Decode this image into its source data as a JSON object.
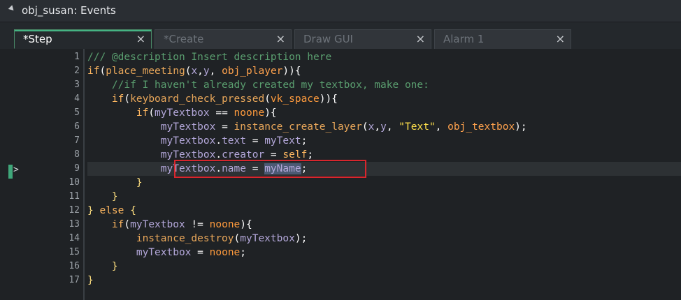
{
  "window": {
    "title": "obj_susan: Events"
  },
  "tabs": [
    {
      "label": "*Step",
      "close": "×",
      "active": true
    },
    {
      "label": "*Create",
      "close": "×",
      "active": false
    },
    {
      "label": "Draw GUI",
      "close": "×",
      "active": false
    },
    {
      "label": "Alarm 1",
      "close": "×",
      "active": false
    }
  ],
  "gutter": {
    "current_line_marker": ">"
  },
  "lines": [
    {
      "num": "1",
      "tokens": [
        {
          "t": "/// @description Insert description here",
          "c": "c-comment"
        }
      ]
    },
    {
      "num": "2",
      "tokens": [
        {
          "t": "if",
          "c": "c-kw"
        },
        {
          "t": "(",
          "c": "c-punct"
        },
        {
          "t": "place_meeting",
          "c": "c-fn"
        },
        {
          "t": "(",
          "c": "c-punct"
        },
        {
          "t": "x",
          "c": "c-var"
        },
        {
          "t": ",",
          "c": "c-punct"
        },
        {
          "t": "y",
          "c": "c-var"
        },
        {
          "t": ", ",
          "c": "c-punct"
        },
        {
          "t": "obj_player",
          "c": "c-obj"
        },
        {
          "t": ")){",
          "c": "c-punct"
        }
      ]
    },
    {
      "num": "3",
      "tokens": [
        {
          "t": "    //if I haven't already created my textbox, make one:",
          "c": "c-comment"
        }
      ]
    },
    {
      "num": "4",
      "tokens": [
        {
          "t": "    ",
          "c": "c-plain"
        },
        {
          "t": "if",
          "c": "c-kw"
        },
        {
          "t": "(",
          "c": "c-punct"
        },
        {
          "t": "keyboard_check_pressed",
          "c": "c-fn"
        },
        {
          "t": "(",
          "c": "c-punct"
        },
        {
          "t": "vk_space",
          "c": "c-const"
        },
        {
          "t": ")){",
          "c": "c-punct"
        }
      ]
    },
    {
      "num": "5",
      "tokens": [
        {
          "t": "        ",
          "c": "c-plain"
        },
        {
          "t": "if",
          "c": "c-kw"
        },
        {
          "t": "(",
          "c": "c-punct"
        },
        {
          "t": "myTextbox",
          "c": "c-var"
        },
        {
          "t": " == ",
          "c": "c-punct"
        },
        {
          "t": "noone",
          "c": "c-const"
        },
        {
          "t": "){",
          "c": "c-punct"
        }
      ]
    },
    {
      "num": "6",
      "tokens": [
        {
          "t": "            ",
          "c": "c-plain"
        },
        {
          "t": "myTextbox",
          "c": "c-var"
        },
        {
          "t": " = ",
          "c": "c-punct"
        },
        {
          "t": "instance_create_layer",
          "c": "c-fn"
        },
        {
          "t": "(",
          "c": "c-punct"
        },
        {
          "t": "x",
          "c": "c-var"
        },
        {
          "t": ",",
          "c": "c-punct"
        },
        {
          "t": "y",
          "c": "c-var"
        },
        {
          "t": ", ",
          "c": "c-punct"
        },
        {
          "t": "\"Text\"",
          "c": "c-str"
        },
        {
          "t": ", ",
          "c": "c-punct"
        },
        {
          "t": "obj_textbox",
          "c": "c-obj"
        },
        {
          "t": ");",
          "c": "c-punct"
        }
      ]
    },
    {
      "num": "7",
      "tokens": [
        {
          "t": "            ",
          "c": "c-plain"
        },
        {
          "t": "myTextbox",
          "c": "c-var"
        },
        {
          "t": ".",
          "c": "c-punct"
        },
        {
          "t": "text",
          "c": "c-var"
        },
        {
          "t": " = ",
          "c": "c-punct"
        },
        {
          "t": "myText",
          "c": "c-var"
        },
        {
          "t": ";",
          "c": "c-punct"
        }
      ]
    },
    {
      "num": "8",
      "tokens": [
        {
          "t": "            ",
          "c": "c-plain"
        },
        {
          "t": "myTextbox",
          "c": "c-var"
        },
        {
          "t": ".",
          "c": "c-punct"
        },
        {
          "t": "creator",
          "c": "c-var"
        },
        {
          "t": " = ",
          "c": "c-punct"
        },
        {
          "t": "self",
          "c": "c-self"
        },
        {
          "t": ";",
          "c": "c-punct"
        }
      ]
    },
    {
      "num": "9",
      "tokens": [
        {
          "t": "            ",
          "c": "c-plain"
        },
        {
          "t": "myTextbox",
          "c": "c-var"
        },
        {
          "t": ".",
          "c": "c-punct"
        },
        {
          "t": "name",
          "c": "c-var"
        },
        {
          "t": " = ",
          "c": "c-punct"
        },
        {
          "t": "myName",
          "c": "c-var sel"
        },
        {
          "t": ";",
          "c": "c-punct"
        }
      ]
    },
    {
      "num": "10",
      "tokens": [
        {
          "t": "        ",
          "c": "c-plain"
        },
        {
          "t": "}",
          "c": "c-brace"
        }
      ]
    },
    {
      "num": "11",
      "tokens": [
        {
          "t": "    ",
          "c": "c-plain"
        },
        {
          "t": "}",
          "c": "c-brace"
        }
      ]
    },
    {
      "num": "12",
      "tokens": [
        {
          "t": "} ",
          "c": "c-brace"
        },
        {
          "t": "else",
          "c": "c-kw"
        },
        {
          "t": " {",
          "c": "c-brace"
        }
      ]
    },
    {
      "num": "13",
      "tokens": [
        {
          "t": "    ",
          "c": "c-plain"
        },
        {
          "t": "if",
          "c": "c-kw"
        },
        {
          "t": "(",
          "c": "c-punct"
        },
        {
          "t": "myTextbox",
          "c": "c-var"
        },
        {
          "t": " != ",
          "c": "c-punct"
        },
        {
          "t": "noone",
          "c": "c-const"
        },
        {
          "t": "){",
          "c": "c-punct"
        }
      ]
    },
    {
      "num": "14",
      "tokens": [
        {
          "t": "        ",
          "c": "c-plain"
        },
        {
          "t": "instance_destroy",
          "c": "c-fn"
        },
        {
          "t": "(",
          "c": "c-punct"
        },
        {
          "t": "myTextbox",
          "c": "c-var"
        },
        {
          "t": ");",
          "c": "c-punct"
        }
      ]
    },
    {
      "num": "15",
      "tokens": [
        {
          "t": "        ",
          "c": "c-plain"
        },
        {
          "t": "myTextbox",
          "c": "c-var"
        },
        {
          "t": " = ",
          "c": "c-punct"
        },
        {
          "t": "noone",
          "c": "c-const"
        },
        {
          "t": ";",
          "c": "c-punct"
        }
      ]
    },
    {
      "num": "16",
      "tokens": [
        {
          "t": "    ",
          "c": "c-plain"
        },
        {
          "t": "}",
          "c": "c-brace"
        }
      ]
    },
    {
      "num": "17",
      "tokens": [
        {
          "t": "}",
          "c": "c-brace"
        }
      ]
    }
  ]
}
